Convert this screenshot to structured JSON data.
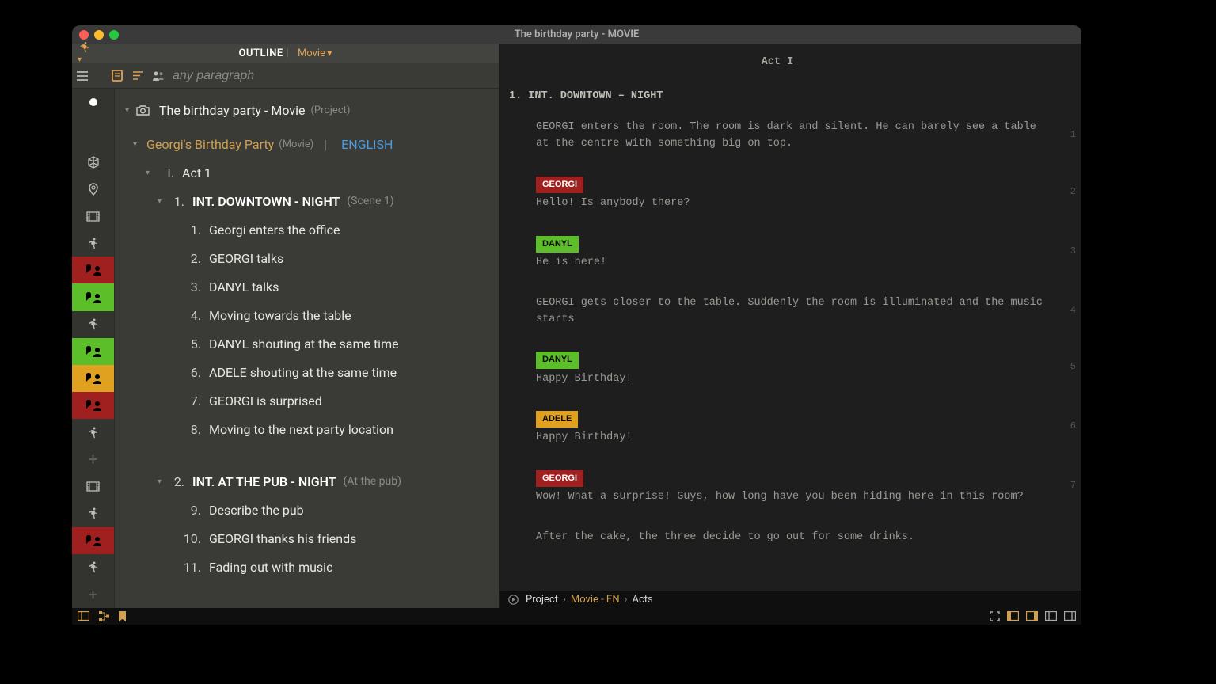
{
  "window_title": "The birthday party - MOVIE",
  "header": {
    "label": "OUTLINE",
    "mode": "Movie"
  },
  "filter": {
    "placeholder": "any paragraph"
  },
  "tree": {
    "project": {
      "title": "The birthday party - Movie",
      "meta": "(Project)"
    },
    "movie": {
      "title": "Georgi's Birthday Party",
      "meta": "(Movie)",
      "lang": "ENGLISH"
    },
    "act": {
      "num": "I.",
      "title": "Act 1"
    },
    "scene1": {
      "num": "1.",
      "title": "INT.  DOWNTOWN - NIGHT",
      "meta": "(Scene 1)"
    },
    "scene2": {
      "num": "2.",
      "title": "INT.  AT THE PUB - NIGHT",
      "meta": "(At the pub)"
    },
    "s1items": [
      {
        "n": "1.",
        "t": "Georgi enters the office"
      },
      {
        "n": "2.",
        "t": "GEORGI talks"
      },
      {
        "n": "3.",
        "t": "DANYL talks"
      },
      {
        "n": "4.",
        "t": "Moving towards the table"
      },
      {
        "n": "5.",
        "t": "DANYL shouting at the same time"
      },
      {
        "n": "6.",
        "t": "ADELE shouting at the same time"
      },
      {
        "n": "7.",
        "t": "GEORGI is surprised"
      },
      {
        "n": "8.",
        "t": "Moving to the next party location"
      }
    ],
    "s2items": [
      {
        "n": "9.",
        "t": "Describe the pub"
      },
      {
        "n": "10.",
        "t": "GEORGI thanks his friends"
      },
      {
        "n": "11.",
        "t": "Fading out with music"
      }
    ]
  },
  "script": {
    "act": "Act I",
    "scene_heading": "1.  INT. DOWNTOWN – NIGHT",
    "blocks": [
      {
        "type": "action",
        "text": "GEORGI enters the room. The room is dark and silent. He can barely see a table at the centre with something big on top.",
        "pn": "1"
      },
      {
        "type": "dlg",
        "char": "GEORGI",
        "cls": "cr",
        "text": "Hello! Is anybody there?",
        "pn": "2"
      },
      {
        "type": "dlg",
        "char": "DANYL",
        "cls": "cg",
        "text": "He is here!",
        "pn": "3"
      },
      {
        "type": "action",
        "text": "GEORGI gets closer to the table. Suddenly the room is illuminated and the music starts",
        "pn": "4"
      },
      {
        "type": "dlg",
        "char": "DANYL",
        "cls": "cg",
        "text": "Happy Birthday!",
        "pn": "5"
      },
      {
        "type": "dlg",
        "char": "ADELE",
        "cls": "cy",
        "text": "Happy Birthday!",
        "pn": "6"
      },
      {
        "type": "dlg",
        "char": "GEORGI",
        "cls": "cr",
        "text": "Wow! What a surprise! Guys, how long have you been hiding here in this room?",
        "pn": "7"
      },
      {
        "type": "action",
        "text": "After the cake, the three decide to go out for some drinks.",
        "pn": ""
      }
    ]
  },
  "breadcrumb": {
    "p1": "Project",
    "p2": "Movie - EN",
    "p3": "Acts"
  }
}
